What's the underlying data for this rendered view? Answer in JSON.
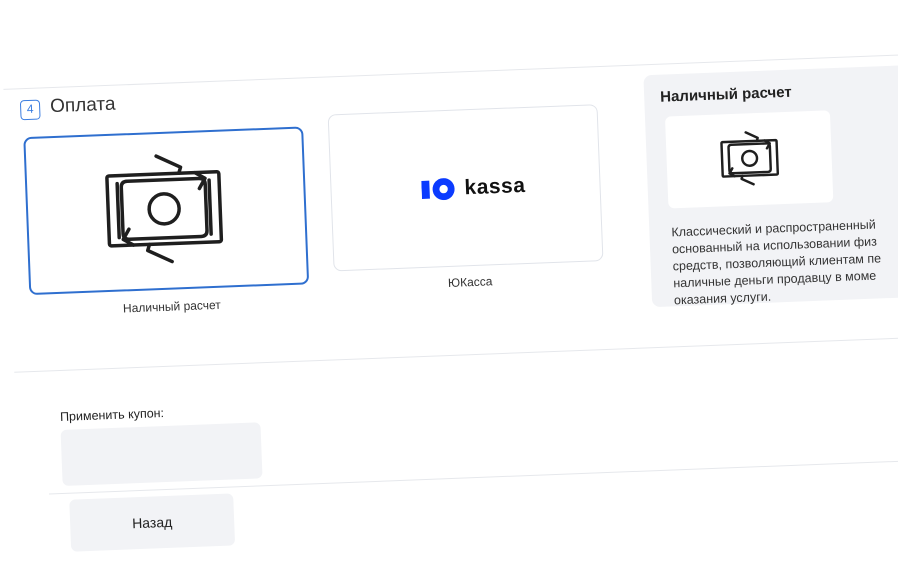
{
  "section": {
    "step_number": "4",
    "title": "Оплата"
  },
  "payment_methods": [
    {
      "label": "Наличный расчет",
      "icon": "cash-icon",
      "selected": true
    },
    {
      "label": "ЮКасса",
      "logo_text": "kassa",
      "icon": "yookassa-logo",
      "selected": false
    }
  ],
  "info_panel": {
    "title": "Наличный расчет",
    "icon": "cash-icon",
    "description_lines": [
      "Классический и распространенный",
      "основанный на использовании физ",
      "средств, позволяющий клиентам пе",
      "наличные деньги продавцу в моме",
      "оказания услуги."
    ]
  },
  "coupon": {
    "label": "Применить купон:",
    "value": "",
    "placeholder": ""
  },
  "buttons": {
    "back_label": "Назад"
  },
  "colors": {
    "accent": "#2f6fcf",
    "yookassa_brand": "#0b3bff",
    "panel_bg": "#f2f3f6"
  }
}
